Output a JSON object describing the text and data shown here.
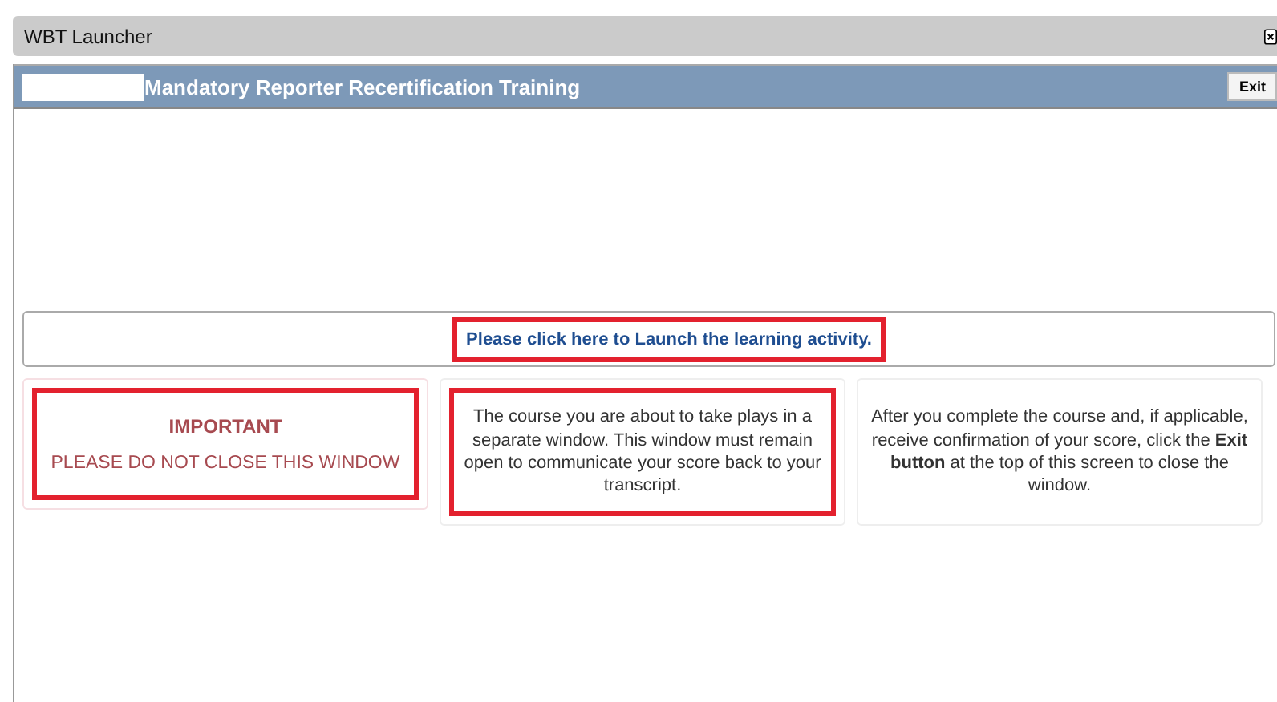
{
  "window": {
    "title": "WBT Launcher"
  },
  "header": {
    "title": "Mandatory Reporter Recertification Training",
    "exit_button": "Exit"
  },
  "launch_link": {
    "text": "Please click here to Launch the learning activity.",
    "highlighted": true
  },
  "cards": [
    {
      "kind": "warning",
      "heading": "IMPORTANT",
      "text": "PLEASE DO NOT CLOSE THIS WINDOW",
      "highlighted": true
    },
    {
      "kind": "info",
      "text": "The course you are about to take plays in a separate window. This window must remain open to communicate your score back to your transcript.",
      "highlighted": true
    },
    {
      "kind": "info",
      "text": "After you complete the course and, if applicable, receive confirmation of your score, click the **Exit button** at the top of this screen to close the window.",
      "highlighted": false
    }
  ]
}
